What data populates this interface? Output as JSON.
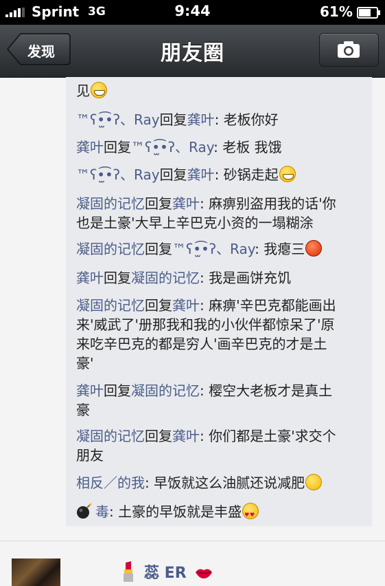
{
  "status_bar": {
    "carrier": "Sprint",
    "network": "3G",
    "time": "9:44",
    "battery": "61%"
  },
  "nav": {
    "back_label": "发现",
    "title": "朋友圈"
  },
  "comments": [
    {
      "parts": [
        {
          "t": "text",
          "v": "见"
        },
        {
          "t": "emoji",
          "v": "grin"
        }
      ]
    },
    {
      "parts": [
        {
          "t": "name",
          "v": "™ʕ•̫͡•ʔ、Ray"
        },
        {
          "t": "text",
          "v": "回复"
        },
        {
          "t": "name",
          "v": "龚叶"
        },
        {
          "t": "text",
          "v": ": 老板你好"
        }
      ]
    },
    {
      "parts": [
        {
          "t": "name",
          "v": "龚叶"
        },
        {
          "t": "text",
          "v": "回复"
        },
        {
          "t": "name",
          "v": "™ʕ•̫͡•ʔ、Ray"
        },
        {
          "t": "text",
          "v": ": 老板 我饿"
        }
      ]
    },
    {
      "parts": [
        {
          "t": "name",
          "v": "™ʕ•̫͡•ʔ、Ray"
        },
        {
          "t": "text",
          "v": "回复"
        },
        {
          "t": "name",
          "v": "龚叶"
        },
        {
          "t": "text",
          "v": ": 砂锅走起"
        },
        {
          "t": "emoji",
          "v": "grin"
        }
      ]
    },
    {
      "lines": [
        [
          {
            "t": "name",
            "v": "凝固的记忆"
          },
          {
            "t": "text",
            "v": "回复"
          },
          {
            "t": "name",
            "v": "龚叶"
          },
          {
            "t": "text",
            "v": ": 麻痹别盗用我的话'你"
          }
        ],
        [
          {
            "t": "text",
            "v": "也是土豪'大早上辛巴克小资的一塌糊涂"
          }
        ]
      ]
    },
    {
      "parts": [
        {
          "t": "name",
          "v": "凝固的记忆"
        },
        {
          "t": "text",
          "v": "回复"
        },
        {
          "t": "name",
          "v": "™ʕ•̫͡•ʔ、Ray"
        },
        {
          "t": "text",
          "v": ": 我瘪三"
        },
        {
          "t": "emoji",
          "v": "angry"
        }
      ]
    },
    {
      "parts": [
        {
          "t": "name",
          "v": "龚叶"
        },
        {
          "t": "text",
          "v": "回复"
        },
        {
          "t": "name",
          "v": "凝固的记忆"
        },
        {
          "t": "text",
          "v": ": 我是画饼充饥"
        }
      ]
    },
    {
      "lines": [
        [
          {
            "t": "name",
            "v": "凝固的记忆"
          },
          {
            "t": "text",
            "v": "回复"
          },
          {
            "t": "name",
            "v": "龚叶"
          },
          {
            "t": "text",
            "v": ": 麻痹'辛巴克都能画出"
          }
        ],
        [
          {
            "t": "text",
            "v": "来'威武了'册那我和我的小伙伴都惊呆了'原"
          }
        ],
        [
          {
            "t": "text",
            "v": "来吃辛巴克的都是穷人'画辛巴克的才是土"
          }
        ],
        [
          {
            "t": "text",
            "v": "豪'"
          }
        ]
      ]
    },
    {
      "lines": [
        [
          {
            "t": "name",
            "v": "龚叶"
          },
          {
            "t": "text",
            "v": "回复"
          },
          {
            "t": "name",
            "v": "凝固的记忆"
          },
          {
            "t": "text",
            "v": ": 樱空大老板才是真土"
          }
        ],
        [
          {
            "t": "text",
            "v": "豪"
          }
        ]
      ]
    },
    {
      "lines": [
        [
          {
            "t": "name",
            "v": "凝固的记忆"
          },
          {
            "t": "text",
            "v": "回复"
          },
          {
            "t": "name",
            "v": "龚叶"
          },
          {
            "t": "text",
            "v": ": 你们都是土豪'求交个"
          }
        ],
        [
          {
            "t": "text",
            "v": "朋友"
          }
        ]
      ]
    },
    {
      "parts": [
        {
          "t": "name",
          "v": "相反／的我"
        },
        {
          "t": "text",
          "v": ": 早饭就这么油腻还说减肥"
        },
        {
          "t": "emoji",
          "v": "relieved"
        }
      ]
    },
    {
      "parts": [
        {
          "t": "icon",
          "v": "bomb"
        },
        {
          "t": "name",
          "v": "毒"
        },
        {
          "t": "text",
          "v": ": 土豪的早饭就是丰盛"
        },
        {
          "t": "emoji",
          "v": "love"
        }
      ]
    }
  ],
  "next_post": {
    "name": "蕊 ER"
  }
}
